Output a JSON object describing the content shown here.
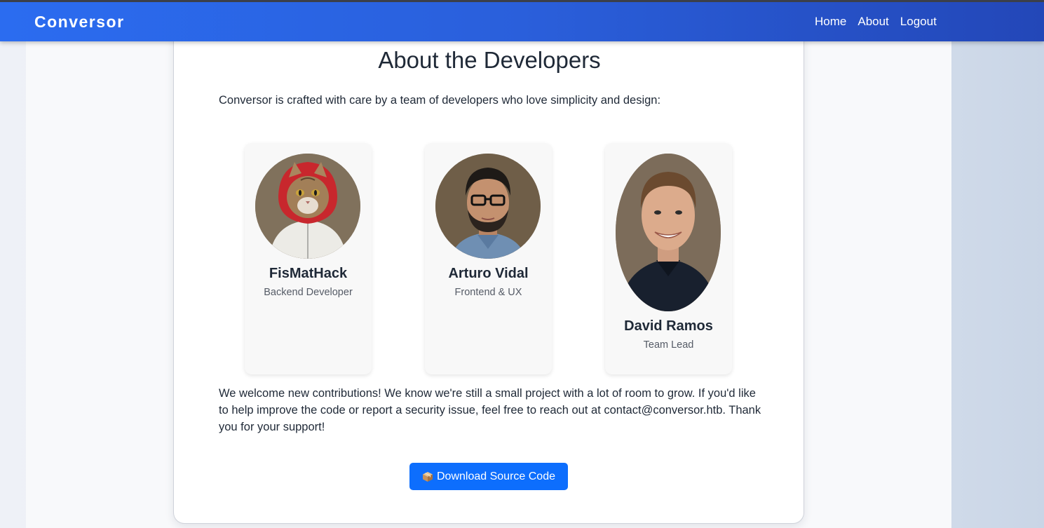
{
  "navbar": {
    "brand": "Conversor",
    "links": [
      {
        "label": "Home"
      },
      {
        "label": "About"
      },
      {
        "label": "Logout"
      }
    ]
  },
  "main": {
    "heading": "About the Developers",
    "intro": "Conversor is crafted with care by a team of developers who love simplicity and design:",
    "developers": [
      {
        "name": "FisMatHack",
        "role": "Backend Developer",
        "avatar": "cat-in-red-hood-avatar"
      },
      {
        "name": "Arturo Vidal",
        "role": "Frontend & UX",
        "avatar": "man-with-glasses-avatar"
      },
      {
        "name": "David Ramos",
        "role": "Team Lead",
        "avatar": "smiling-man-avatar"
      }
    ],
    "outro": "We welcome new contributions! We know we're still a small project with a lot of room to grow. If you'd like to help improve the code or report a security issue, feel free to reach out at contact@conversor.htb. Thank you for your support!",
    "download_label": "Download Source Code",
    "download_icon": "package-icon"
  },
  "colors": {
    "navbar": "#2a5fdb",
    "button": "#0d6efd",
    "text": "#1f2937"
  }
}
